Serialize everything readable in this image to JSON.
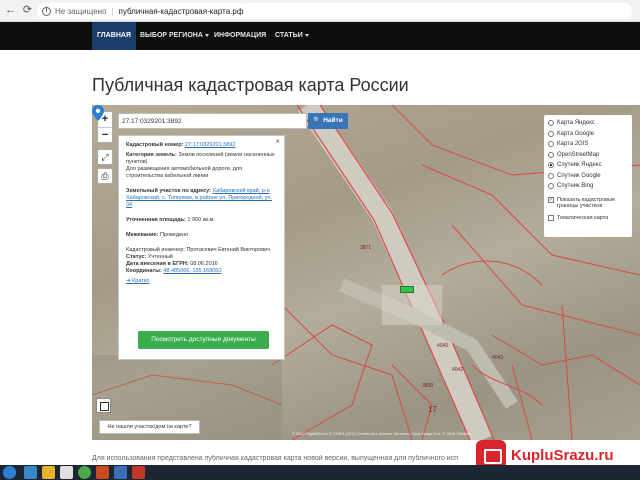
{
  "browser": {
    "secure_label": "Не защищено",
    "url": "публичная-кадастровая-карта.рф"
  },
  "navbar": {
    "items": [
      {
        "label": "ГЛАВНАЯ",
        "active": true
      },
      {
        "label": "ВЫБОР РЕГИОНА",
        "dropdown": true
      },
      {
        "label": "ИНФОРМАЦИЯ"
      },
      {
        "label": "СТАТЬИ",
        "dropdown": true
      }
    ]
  },
  "page": {
    "title": "Публичная кадастровая карта России",
    "below_text": "Для использования представлена публичная кадастровая карта новой версии, выпущенная для публичного исп"
  },
  "map": {
    "search_value": "27:17:0329201:3892",
    "search_button": "Найти",
    "zoom_in": "+",
    "zoom_out": "−",
    "not_found_label": "Не нашли участок/дом на карте?",
    "attribution": "© 2012 DigitalGlobe © CNES (2012) Distribution Astrium Services / Spot Image S.A. © 2016 Ofwlabs",
    "parcel_numbers": [
      "3871",
      "4040",
      "4042",
      "3850",
      "4043",
      "17"
    ]
  },
  "layers": {
    "options": [
      {
        "label": "Карта Яндекс",
        "selected": false
      },
      {
        "label": "Карта Google",
        "selected": false
      },
      {
        "label": "Карта 2GIS",
        "selected": false
      },
      {
        "label": "OpenStreetMap",
        "selected": false
      },
      {
        "label": "Спутник Яндекс",
        "selected": true
      },
      {
        "label": "Спутник Google",
        "selected": false
      },
      {
        "label": "Спутник Bing",
        "selected": false
      }
    ],
    "show_boundaries": "Показать кадастровые границы участков",
    "thematic_map": "Тематическая карта"
  },
  "popup": {
    "cadastral_label": "Кадастровый номер:",
    "cadastral_value": "27:17:0329201:3892",
    "category_label": "Категория земель:",
    "category_value": "Земли поселений (земли населенных пунктов)",
    "purpose_value": "Для размещения автомобильной дороги, для строительства кабельной линии",
    "address_label": "Земельный участок по адресу:",
    "address_value": "Хабаровский край, р-н Хабаровский, с. Тополево, в районе ул. Пригородной, уч. 34",
    "area_label": "Уточненная площадь:",
    "area_value": "1 900 кв.м.",
    "survey_label": "Межевание:",
    "survey_value": "Проведено",
    "engineer_label": "Кадастровый инженер:",
    "engineer_value": "Протасевич Евгений Викторович",
    "status_label": "Статус:",
    "status_value": "Учтенный",
    "date_label": "Дата внесения в ЕГРН:",
    "date_value": "08.06.2016",
    "coords_label": "Координаты:",
    "coords_value": "48.485066, 135.168060",
    "short_link": "Кратко",
    "docs_button": "Посмотреть доступные документы"
  },
  "watermark": {
    "text": "KupluSrazu.ru"
  },
  "colors": {
    "navbar_bg": "#0e0e0e",
    "nav_active": "#1b3f6b",
    "search_btn": "#3a74b8",
    "docs_btn": "#3aad4e",
    "watermark": "#d8262c"
  }
}
